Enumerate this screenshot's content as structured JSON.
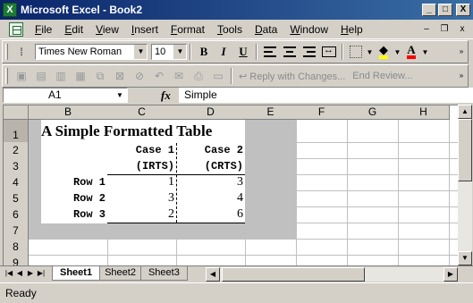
{
  "window": {
    "title": "Microsoft Excel - Book2",
    "app_icon_letter": "X",
    "minimize": "_",
    "maximize": "□",
    "close": "X"
  },
  "menu": {
    "items": [
      "File",
      "Edit",
      "View",
      "Insert",
      "Format",
      "Tools",
      "Data",
      "Window",
      "Help"
    ],
    "doc_minimize": "–",
    "doc_restore": "❐",
    "doc_close": "x"
  },
  "formatting_toolbar": {
    "font_name": "Times New Roman",
    "font_size": "10",
    "bold": "B",
    "italic": "I",
    "underline": "U",
    "font_color_letter": "A"
  },
  "reviewing_toolbar": {
    "reply_with_changes": "Reply with Changes...",
    "end_review": "End Review..."
  },
  "formula_bar": {
    "name_box": "A1",
    "fx": "fx",
    "content": "Simple"
  },
  "grid": {
    "columns": [
      "B",
      "C",
      "D",
      "E",
      "F",
      "G",
      "H"
    ],
    "rows": [
      "1",
      "2",
      "3",
      "4",
      "5",
      "6",
      "7",
      "8",
      "9"
    ],
    "cells": {
      "title": "A Simple Formatted Table",
      "case1": "Case 1",
      "case2": "Case 2",
      "irts": "(IRTS)",
      "crts": "(CRTS)",
      "row1": "Row 1",
      "row2": "Row 2",
      "row3": "Row 3",
      "r1c1": "1",
      "r1c2": "3",
      "r2c1": "3",
      "r2c2": "4",
      "r3c1": "2",
      "r3c2": "6"
    }
  },
  "sheets": {
    "tabs": [
      "Sheet1",
      "Sheet2",
      "Sheet3"
    ],
    "active": "Sheet1"
  },
  "status": {
    "text": "Ready"
  }
}
